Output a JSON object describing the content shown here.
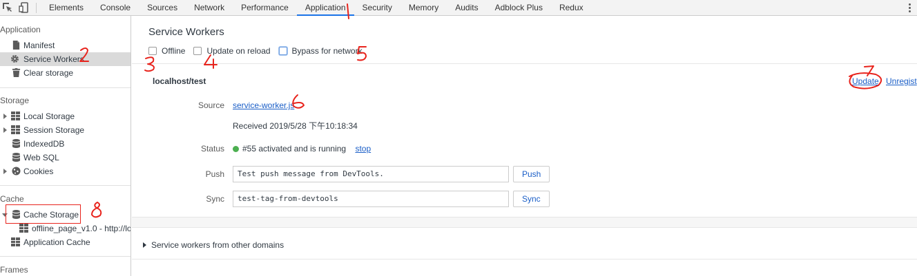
{
  "topbar": {
    "tabs": [
      "Elements",
      "Console",
      "Sources",
      "Network",
      "Performance",
      "Application",
      "Security",
      "Memory",
      "Audits",
      "Adblock Plus",
      "Redux"
    ],
    "active_tab": "Application",
    "icons": [
      "inspect-icon",
      "device-toolbar-icon",
      "more-options-icon"
    ]
  },
  "sidebar": {
    "sections": {
      "application": "Application",
      "storage": "Storage",
      "cache": "Cache",
      "frames": "Frames"
    },
    "application_items": [
      "Manifest",
      "Service Workers",
      "Clear storage"
    ],
    "storage_items": [
      "Local Storage",
      "Session Storage",
      "IndexedDB",
      "Web SQL",
      "Cookies"
    ],
    "cache_items": [
      "Cache Storage",
      "offline_page_v1.0 - http://lo",
      "Application Cache"
    ],
    "selected_item": "Service Workers"
  },
  "main": {
    "title": "Service Workers",
    "options": {
      "offline": "Offline",
      "update_on_reload": "Update on reload",
      "bypass_for_network": "Bypass for network"
    },
    "worker": {
      "scope": "localhost/test",
      "update_link": "Update",
      "unregister_link": "Unregist",
      "source_label": "Source",
      "source_file": "service-worker.js",
      "received": "Received 2019/5/28 下午10:18:34",
      "status_label": "Status",
      "status_text": "#55 activated and is running",
      "stop_link": "stop",
      "status_color": "#4caf50",
      "push_label": "Push",
      "push_value": "Test push message from DevTools.",
      "push_button": "Push",
      "sync_label": "Sync",
      "sync_value": "test-tag-from-devtools",
      "sync_button": "Sync"
    },
    "other_domains": "Service workers from other domains"
  },
  "annotations": [
    "1",
    "2",
    "3",
    "4",
    "5",
    "6",
    "7",
    "8"
  ],
  "colors": {
    "accent": "#1a73e8",
    "link": "#1a5ec7",
    "annotation": "#e8231c",
    "selected_bg": "#dadada"
  }
}
